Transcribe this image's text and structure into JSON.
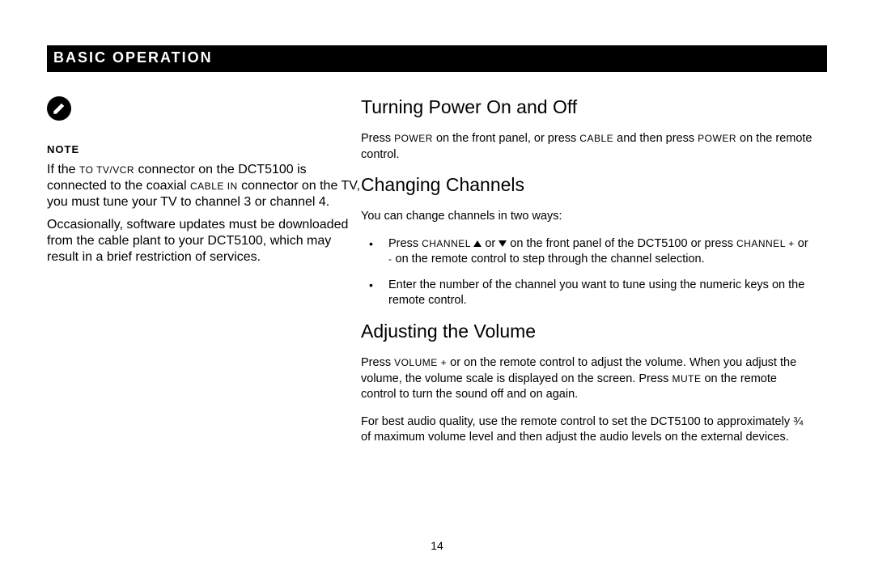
{
  "header": "BASIC OPERATION",
  "note": {
    "label": "NOTE",
    "para1_a": "If the ",
    "para1_sc1": "TO TV/VCR",
    "para1_b": " connector on the DCT5100 is connected to the coaxial ",
    "para1_sc2": "CABLE IN",
    "para1_c": " connector on the TV, you must tune your TV to channel 3 or channel 4.",
    "para2": "Occasionally, software updates must be downloaded from the cable plant to your DCT5100, which may result in a brief restriction of services."
  },
  "sections": {
    "power": {
      "title": "Turning Power On and Off",
      "p_a": "Press ",
      "p_sc1": "POWER",
      "p_b": " on the front panel, or press ",
      "p_sc2": "CABLE",
      "p_c": " and then press ",
      "p_sc3": "POWER",
      "p_d": " on the remote control."
    },
    "channels": {
      "title": "Changing Channels",
      "intro": "You can change channels in two ways:",
      "b1_a": "Press ",
      "b1_sc1": "CHANNEL ",
      "b1_b": " or ",
      "b1_c": " on the front panel of the DCT5100 or press ",
      "b1_sc2": "CHANNEL +",
      "b1_d": " or ",
      "b1_sc3": "-",
      "b1_e": "  on the remote control to step through the channel selection.",
      "b2": "Enter the number of the channel you want to tune using the numeric keys on the remote control."
    },
    "volume": {
      "title": "Adjusting the Volume",
      "p1_a": "Press ",
      "p1_sc1": "VOLUME +",
      "p1_b": "  or     on the remote control to adjust the volume. When you adjust the volume, the volume scale is displayed on the screen. Press ",
      "p1_sc2": "MUTE",
      "p1_c": " on the remote control to turn the sound off and on again.",
      "p2": "For best audio quality, use the remote control to set the DCT5100 to approximately ¾ of maximum volume level and then adjust the audio levels on the external devices."
    }
  },
  "page_number": "14"
}
